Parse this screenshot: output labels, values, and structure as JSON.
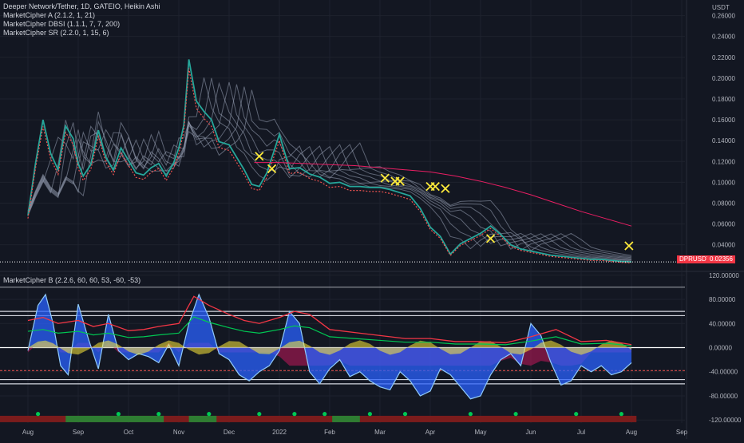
{
  "legend": {
    "symbol": "Deeper Network/Tether, 1D, GATEIO, Heikin Ashi",
    "ind_a": "MarketCipher A (2.1.2, 1, 21)",
    "ind_dbsi": "MarketCipher DBSI (1.1.1, 7, 7, 200)",
    "ind_sr": "MarketCipher SR (2.2.0, 1, 15, 6)",
    "ind_b": "MarketCipher B (2.2.6, 60, 60, 53, -60, -53)"
  },
  "price_axis": {
    "unit": "USDT",
    "ticks": [
      "0.26000",
      "0.24000",
      "0.22000",
      "0.20000",
      "0.18000",
      "0.16000",
      "0.14000",
      "0.12000",
      "0.10000",
      "0.08000",
      "0.06000",
      "0.04000"
    ],
    "tick_values": [
      0.26,
      0.24,
      0.22,
      0.2,
      0.18,
      0.16,
      0.14,
      0.12,
      0.1,
      0.08,
      0.06,
      0.04
    ],
    "range": [
      0.016,
      0.275
    ]
  },
  "osc_axis": {
    "ticks": [
      "120.00000",
      "80.00000",
      "40.00000",
      "0.00000",
      "-40.00000",
      "-80.00000",
      "-120.00000"
    ],
    "tick_values": [
      120,
      80,
      40,
      0,
      -40,
      -80,
      -120
    ],
    "range": [
      -125,
      125
    ],
    "levels": [
      100,
      60,
      53,
      -53,
      -60
    ]
  },
  "time_axis": {
    "labels": [
      "Aug",
      "Sep",
      "Oct",
      "Nov",
      "Dec",
      "2022",
      "Feb",
      "Mar",
      "Apr",
      "May",
      "Jun",
      "Jul",
      "Aug",
      "Sep"
    ],
    "months_index": [
      0,
      1,
      2,
      3,
      4,
      5,
      6,
      7,
      8,
      9,
      10,
      11,
      12,
      13
    ]
  },
  "current": {
    "symbol_tag": "DPRUSDT",
    "price_tag": "0.02356",
    "value": 0.02356
  },
  "colors": {
    "background": "#131722",
    "up": "#26a69a",
    "down": "#ef5350",
    "ribbon": "#9aa4b8",
    "wave_blue": "#2962ff",
    "money_flow_red": "#c2185b",
    "money_flow_green": "#00c853",
    "yellow": "#ffeb3b",
    "tag_red": "#f23645"
  },
  "chart_data": [
    {
      "type": "line",
      "name_ref": "legend.symbol",
      "x_unit": "month (0 = Aug 2021)",
      "x": [
        0.0,
        0.15,
        0.3,
        0.45,
        0.6,
        0.75,
        0.9,
        1.0,
        1.1,
        1.25,
        1.4,
        1.55,
        1.7,
        1.85,
        2.0,
        2.15,
        2.3,
        2.45,
        2.6,
        2.75,
        2.9,
        3.0,
        3.1,
        3.2,
        3.35,
        3.5,
        3.65,
        3.8,
        4.0,
        4.15,
        4.3,
        4.45,
        4.6,
        4.75,
        4.9,
        5.0,
        5.2,
        5.4,
        5.6,
        5.8,
        6.0,
        6.2,
        6.4,
        6.6,
        6.8,
        7.0,
        7.2,
        7.4,
        7.6,
        7.8,
        8.0,
        8.2,
        8.4,
        8.6,
        8.8,
        9.0,
        9.2,
        9.4,
        9.6,
        9.8,
        10.0,
        10.2,
        10.4,
        10.6,
        10.8,
        11.0,
        11.2,
        11.4,
        11.6,
        11.8,
        12.0
      ],
      "y": [
        0.068,
        0.118,
        0.16,
        0.128,
        0.112,
        0.154,
        0.142,
        0.118,
        0.106,
        0.117,
        0.15,
        0.124,
        0.112,
        0.133,
        0.121,
        0.109,
        0.107,
        0.114,
        0.118,
        0.106,
        0.119,
        0.133,
        0.155,
        0.218,
        0.178,
        0.168,
        0.16,
        0.139,
        0.136,
        0.124,
        0.112,
        0.098,
        0.096,
        0.109,
        0.131,
        0.146,
        0.113,
        0.114,
        0.108,
        0.105,
        0.099,
        0.1,
        0.096,
        0.096,
        0.095,
        0.095,
        0.093,
        0.09,
        0.087,
        0.075,
        0.057,
        0.048,
        0.031,
        0.041,
        0.046,
        0.051,
        0.058,
        0.05,
        0.04,
        0.036,
        0.034,
        0.032,
        0.03,
        0.029,
        0.028,
        0.027,
        0.026,
        0.026,
        0.025,
        0.024,
        0.02356
      ]
    },
    {
      "type": "line",
      "name_ref": "legend.ind_a",
      "x_unit": "month (0 = Aug 2021)",
      "x": [
        4.5,
        5.0,
        5.5,
        6.0,
        6.5,
        7.0,
        7.5,
        8.0,
        8.5,
        9.0,
        9.5,
        10.0,
        10.5,
        11.0,
        11.5,
        12.0
      ],
      "y": [
        0.119,
        0.119,
        0.118,
        0.117,
        0.116,
        0.114,
        0.112,
        0.11,
        0.106,
        0.101,
        0.095,
        0.088,
        0.08,
        0.072,
        0.065,
        0.058
      ]
    },
    {
      "type": "area",
      "name_ref": "legend.ind_b",
      "x_unit": "month (0 = Aug 2021)",
      "x": [
        0.0,
        0.2,
        0.35,
        0.5,
        0.65,
        0.8,
        1.0,
        1.2,
        1.4,
        1.6,
        1.8,
        2.0,
        2.2,
        2.4,
        2.6,
        2.8,
        3.0,
        3.2,
        3.4,
        3.6,
        3.8,
        4.0,
        4.2,
        4.4,
        4.6,
        4.8,
        5.0,
        5.2,
        5.4,
        5.6,
        5.8,
        6.0,
        6.2,
        6.4,
        6.6,
        6.8,
        7.0,
        7.2,
        7.4,
        7.6,
        7.8,
        8.0,
        8.2,
        8.4,
        8.6,
        8.8,
        9.0,
        9.2,
        9.4,
        9.6,
        9.8,
        10.0,
        10.2,
        10.4,
        10.6,
        10.8,
        11.0,
        11.2,
        11.4,
        11.6,
        11.8,
        12.0
      ],
      "y": [
        -5,
        70,
        88,
        40,
        -30,
        -45,
        72,
        15,
        -35,
        55,
        -5,
        -20,
        -10,
        -15,
        -25,
        5,
        -30,
        40,
        88,
        50,
        -10,
        -20,
        -45,
        -55,
        -40,
        -30,
        -5,
        60,
        40,
        -40,
        -60,
        -35,
        -20,
        -48,
        -40,
        -55,
        -65,
        -70,
        -40,
        -55,
        -80,
        -72,
        -35,
        -45,
        -65,
        -85,
        -80,
        -45,
        -20,
        -10,
        -30,
        40,
        20,
        -25,
        -62,
        -55,
        -30,
        -40,
        -30,
        -45,
        -40,
        -25
      ]
    },
    {
      "type": "line",
      "name_ref": "legend.ind_b",
      "x_unit": "month (0 = Aug 2021)",
      "x": [
        0.0,
        0.3,
        0.6,
        1.0,
        1.3,
        1.6,
        2.0,
        2.3,
        2.6,
        3.0,
        3.3,
        3.6,
        4.0,
        4.3,
        4.6,
        5.0,
        5.3,
        5.6,
        6.0,
        6.5,
        7.0,
        7.5,
        8.0,
        8.5,
        9.0,
        9.5,
        10.0,
        10.5,
        11.0,
        11.5,
        12.0
      ],
      "y": [
        45,
        50,
        40,
        45,
        35,
        40,
        28,
        30,
        35,
        40,
        85,
        70,
        55,
        45,
        40,
        50,
        60,
        55,
        30,
        25,
        20,
        15,
        15,
        10,
        10,
        8,
        18,
        30,
        10,
        12,
        5
      ]
    }
  ],
  "markers": {
    "yellow_x_months": [
      4.6,
      4.85,
      7.1,
      7.3,
      7.4,
      8.0,
      8.1,
      8.3,
      9.2,
      11.95
    ],
    "yellow_x_prices": [
      0.125,
      0.113,
      0.104,
      0.101,
      0.101,
      0.096,
      0.096,
      0.094,
      0.046,
      0.039
    ],
    "green_dot_months": [
      0.2,
      1.8,
      2.6,
      3.6,
      4.6,
      5.3,
      5.9,
      6.8,
      7.5,
      8.8,
      9.7,
      10.9,
      11.8
    ],
    "green_dot_values": [
      -110,
      -110,
      -110,
      -110,
      -110,
      -110,
      -110,
      -110,
      -110,
      -110,
      -110,
      -110,
      -110
    ]
  }
}
